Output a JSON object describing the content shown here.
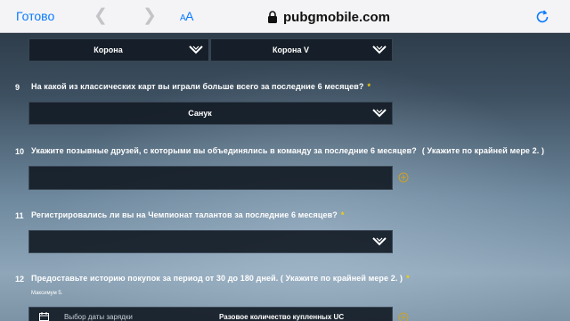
{
  "browser": {
    "done_label": "Готово",
    "text_size_label_small": "A",
    "text_size_label_large": "A",
    "url": "pubgmobile.com"
  },
  "top_row": {
    "select_left": "Корона",
    "select_right": "Корона V"
  },
  "q9": {
    "number": "9",
    "text": "На какой из классических карт вы играли больше всего за последние 6 месяцев?",
    "required_mark": "*",
    "selected": "Санук"
  },
  "q10": {
    "number": "10",
    "text": "Укажите позывные друзей, с которыми вы объединялись в команду за последние 6 месяцев?",
    "hint": "( Укажите по крайней мере 2. )",
    "value": ""
  },
  "q11": {
    "number": "11",
    "text": "Регистрировались ли вы на Чемпионат талантов за последние 6 месяцев?",
    "required_mark": "*",
    "selected": ""
  },
  "q12": {
    "number": "12",
    "text": "Предоставьте историю покупок за период от 30 до 180 дней. ( Укажите по крайней мере 2. )",
    "required_mark": "*",
    "max_note": "Максимум 5.",
    "date_placeholder": "Выбор даты зарядки",
    "quantity_placeholder": "Разовое количество купленных UC"
  },
  "colors": {
    "accent": "#0a7aff",
    "required": "#f5d300",
    "add_icon": "#c9a227"
  }
}
